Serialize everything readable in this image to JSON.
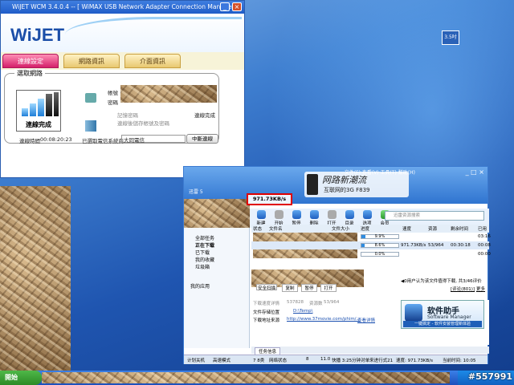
{
  "desktop": {
    "icon_label": "3.5吋"
  },
  "wcm": {
    "title": "WiJET WCM 3.4.0.4 -- [ WiMAX USB Network Adapter Connection Manager ]",
    "logo": "WiJET",
    "tabs": [
      "連線設定",
      "網路資訊",
      "介面資訊"
    ],
    "group_label": "選取網路",
    "signal_status": "連線完成",
    "conn_time_label": "連線時間",
    "conn_time": "00:08:20:23",
    "account_label": "帳號",
    "password_label": "密碼",
    "remember_label": "記憶密碼",
    "save_label": "連線後儲存帳號及密碼",
    "connected_status": "連線完成",
    "nsp_label": "已選取電信系統商",
    "nsp_value": "大同電信",
    "disconnect_button": "中斷連線"
  },
  "xunlei": {
    "window_title": "迅雷 5",
    "menu": "文件(F)  查看(V)  工具(T)  幫助(H)",
    "logo_title": "网路新潮流",
    "logo_sub": "互联网的3G  F839",
    "speed": "971.73KB/s",
    "toolbar": [
      "新建",
      "开始",
      "暂停",
      "删除",
      "打开",
      "目录",
      "选项",
      "会员"
    ],
    "search_placeholder": "迅雷资源搜索",
    "sidebar": [
      "全部任务",
      "正在下载",
      "已下载",
      "我的收藏",
      "垃圾箱",
      "我的应用"
    ],
    "list_headers": [
      "状态",
      "文件名",
      "文件大小",
      "进度",
      "速度",
      "资源",
      "剩余时间",
      "已用"
    ],
    "rows": [
      {
        "progress_text": "9.9%",
        "progress": 0.099,
        "speed": "",
        "res": "",
        "remain": "",
        "used": "03:16"
      },
      {
        "progress_text": "8.6%",
        "progress": 0.086,
        "speed": "971.73KB/s",
        "res": "53/964",
        "remain": "00:30:18",
        "used": "00:08"
      },
      {
        "progress_text": "0.0%",
        "progress": 0.0,
        "speed": "",
        "res": "",
        "remain": "",
        "used": "00:00"
      }
    ],
    "ad_links": [
      "安全扫描",
      "复制",
      "暂停",
      "打开"
    ],
    "notice": "◀0用户认为该文件值得下载, 共3/46评价",
    "rate_label": "[评论(801)]",
    "more_label": "更多",
    "detail": {
      "speed_label": "下载速度详情",
      "speed_value": "537828",
      "res_label": "资源数",
      "res_value": "53/964",
      "save_label": "文件存储位置",
      "save_value": "D:\\Temp\\",
      "url_label": "下载地址来源",
      "url_value": "http://www.37movie.com/phim/...",
      "view_label": "查看详情"
    },
    "software_manager": {
      "title": "软件助手",
      "subtitle": "Software Manager",
      "button": "一键搞定 - 软件安装管理新体验"
    },
    "bottom_tab": "任务信息",
    "status": [
      "计划关机",
      "高速模式",
      "7 8类",
      "网络状态",
      "8",
      "11.0"
    ],
    "status_right": "快播 3:25分钟对单来进行式21",
    "status_speed": "速度: 971.73KB/s",
    "status_time": "当前时间: 10:05"
  },
  "taskbar": {
    "start": "開始",
    "watermark": "#557991"
  }
}
